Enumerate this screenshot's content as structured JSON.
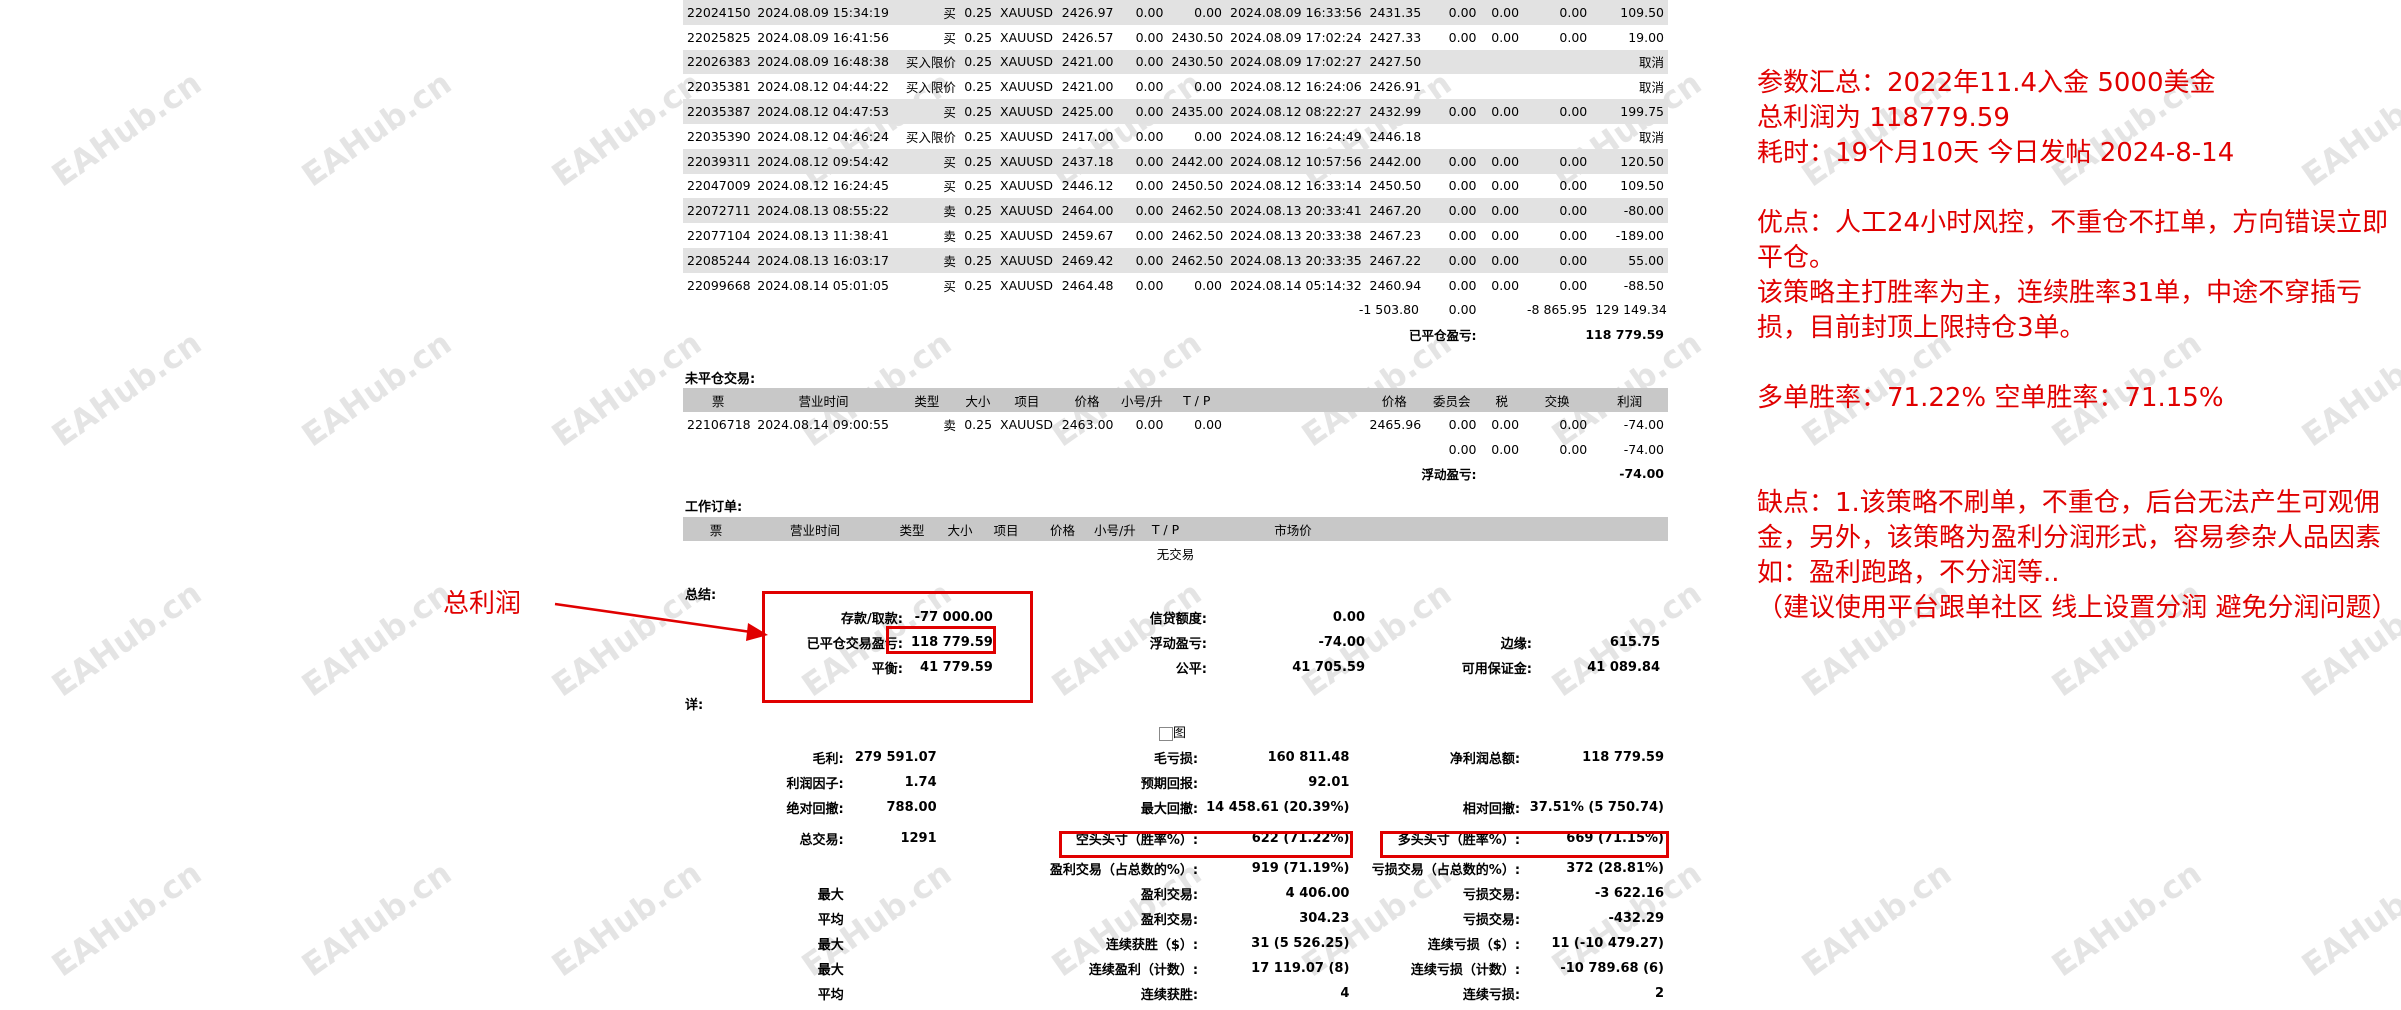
{
  "closed_trades": [
    [
      "22024150",
      "2024.08.09 15:34:19",
      "买",
      "0.25",
      "XAUUSD",
      "2426.97",
      "0.00",
      "0.00",
      "2024.08.09 16:33:56",
      "2431.35",
      "0.00",
      "0.00",
      "0.00",
      "109.50"
    ],
    [
      "22025825",
      "2024.08.09 16:41:56",
      "买",
      "0.25",
      "XAUUSD",
      "2426.57",
      "0.00",
      "2430.50",
      "2024.08.09 17:02:24",
      "2427.33",
      "0.00",
      "0.00",
      "0.00",
      "19.00"
    ],
    [
      "22026383",
      "2024.08.09 16:48:38",
      "买入限价",
      "0.25",
      "XAUUSD",
      "2421.00",
      "0.00",
      "2430.50",
      "2024.08.09 17:02:27",
      "2427.50",
      "",
      "",
      "",
      "取消"
    ],
    [
      "22035381",
      "2024.08.12 04:44:22",
      "买入限价",
      "0.25",
      "XAUUSD",
      "2421.00",
      "0.00",
      "0.00",
      "2024.08.12 16:24:06",
      "2426.91",
      "",
      "",
      "",
      "取消"
    ],
    [
      "22035387",
      "2024.08.12 04:47:53",
      "买",
      "0.25",
      "XAUUSD",
      "2425.00",
      "0.00",
      "2435.00",
      "2024.08.12 08:22:27",
      "2432.99",
      "0.00",
      "0.00",
      "0.00",
      "199.75"
    ],
    [
      "22035390",
      "2024.08.12 04:46:24",
      "买入限价",
      "0.25",
      "XAUUSD",
      "2417.00",
      "0.00",
      "0.00",
      "2024.08.12 16:24:49",
      "2446.18",
      "",
      "",
      "",
      "取消"
    ],
    [
      "22039311",
      "2024.08.12 09:54:42",
      "买",
      "0.25",
      "XAUUSD",
      "2437.18",
      "0.00",
      "2442.00",
      "2024.08.12 10:57:56",
      "2442.00",
      "0.00",
      "0.00",
      "0.00",
      "120.50"
    ],
    [
      "22047009",
      "2024.08.12 16:24:45",
      "买",
      "0.25",
      "XAUUSD",
      "2446.12",
      "0.00",
      "2450.50",
      "2024.08.12 16:33:14",
      "2450.50",
      "0.00",
      "0.00",
      "0.00",
      "109.50"
    ],
    [
      "22072711",
      "2024.08.13 08:55:22",
      "卖",
      "0.25",
      "XAUUSD",
      "2464.00",
      "0.00",
      "2462.50",
      "2024.08.13 20:33:41",
      "2467.20",
      "0.00",
      "0.00",
      "0.00",
      "-80.00"
    ],
    [
      "22077104",
      "2024.08.13 11:38:41",
      "卖",
      "0.25",
      "XAUUSD",
      "2459.67",
      "0.00",
      "2462.50",
      "2024.08.13 20:33:38",
      "2467.23",
      "0.00",
      "0.00",
      "0.00",
      "-189.00"
    ],
    [
      "22085244",
      "2024.08.13 16:03:17",
      "卖",
      "0.25",
      "XAUUSD",
      "2469.42",
      "0.00",
      "2462.50",
      "2024.08.13 20:33:35",
      "2467.22",
      "0.00",
      "0.00",
      "0.00",
      "55.00"
    ],
    [
      "22099668",
      "2024.08.14 05:01:05",
      "买",
      "0.25",
      "XAUUSD",
      "2464.48",
      "0.00",
      "0.00",
      "2024.08.14 05:14:32",
      "2460.94",
      "0.00",
      "0.00",
      "0.00",
      "-88.50"
    ]
  ],
  "closed_totals": {
    "commission": "-1 503.80",
    "tax": "0.00",
    "swap": "-8 865.95",
    "profit": "129 149.34"
  },
  "closed_pl": {
    "label": "已平仓盈亏:",
    "value": "118 779.59"
  },
  "open_section": {
    "title": "未平仓交易:",
    "headers": [
      "票",
      "营业时间",
      "类型",
      "大小",
      "项目",
      "价格",
      "小号/升",
      "T / P",
      "",
      "价格",
      "委员会",
      "税",
      "交换",
      "利润"
    ],
    "row": [
      "22106718",
      "2024.08.14 09:00:55",
      "卖",
      "0.25",
      "XAUUSD",
      "2463.00",
      "0.00",
      "0.00",
      "",
      "2465.96",
      "0.00",
      "0.00",
      "0.00",
      "-74.00"
    ],
    "subtotal": [
      "0.00",
      "0.00",
      "0.00",
      "-74.00"
    ],
    "float_label": "浮动盈亏:",
    "float_value": "-74.00"
  },
  "work_section": {
    "title": "工作订单:",
    "headers": [
      "票",
      "营业时间",
      "类型",
      "大小",
      "项目",
      "价格",
      "小号/升",
      "T / P",
      "市场价",
      ""
    ],
    "empty": "无交易"
  },
  "summary": {
    "title": "总结:",
    "deposit_label": "存款/取款:",
    "deposit": "-77 000.00",
    "closed_label": "已平仓交易盈亏:",
    "closed": "118 779.59",
    "balance_label": "平衡:",
    "balance": "41 779.59",
    "credit_label": "信贷额度:",
    "credit": "0.00",
    "float_label": "浮动盈亏:",
    "float": "-74.00",
    "equity_label": "公平:",
    "equity": "41 705.59",
    "margin_label": "边缘:",
    "margin": "615.75",
    "free_label": "可用保证金:",
    "free": "41 089.84"
  },
  "details": {
    "title": "详:",
    "image_alt": "图",
    "rows": [
      [
        "毛利:",
        "279 591.07",
        "毛亏损:",
        "160 811.48",
        "净利润总额:",
        "118 779.59"
      ],
      [
        "利润因子:",
        "1.74",
        "预期回报:",
        "92.01",
        "",
        ""
      ],
      [
        "绝对回撤:",
        "788.00",
        "最大回撤:",
        "14 458.61 (20.39%)",
        "相对回撤:",
        "37.51% (5 750.74)"
      ],
      [
        "总交易:",
        "1291",
        "空头头寸（胜率%）:",
        "622 (71.22%)",
        "多头头寸（胜率%）:",
        "669 (71.15%)"
      ],
      [
        "",
        "",
        "盈利交易（占总数的%）:",
        "919 (71.19%)",
        "亏损交易（占总数的%）:",
        "372 (28.81%)"
      ],
      [
        "最大",
        "",
        "盈利交易:",
        "4 406.00",
        "亏损交易:",
        "-3 622.16"
      ],
      [
        "平均",
        "",
        "盈利交易:",
        "304.23",
        "亏损交易:",
        "-432.29"
      ],
      [
        "最大",
        "",
        "连续获胜（$）:",
        "31 (5 526.25)",
        "连续亏损（$）:",
        "11 (-10 479.27)"
      ],
      [
        "最大",
        "",
        "连续盈利（计数）:",
        "17 119.07 (8)",
        "连续亏损（计数）:",
        "-10 789.68 (6)"
      ],
      [
        "平均",
        "",
        "连续获胜:",
        "4",
        "连续亏损:",
        "2"
      ]
    ]
  },
  "annotation_label": "总利润",
  "notes": {
    "l1": "参数汇总：2022年11.4入金 5000美金",
    "l2": "总利润为 118779.59",
    "l3": "耗时：19个月10天 今日发帖 2024-8-14",
    "l4": "优点：人工24小时风控，不重仓不扛单，方向错误立即平仓。",
    "l5": "该策略主打胜率为主，连续胜率31单，中途不穿插亏损，目前封顶上限持仓3单。",
    "l6": "多单胜率：71.22%  空单胜率：71.15%",
    "l7": "缺点：1.该策略不刷单，不重仓，后台无法产生可观佣金，另外，该策略为盈利分润形式，容易参杂人品因素如：盈利跑路，不分润等..",
    "l8": "（建议使用平台跟单社区 线上设置分润 避免分润问题）"
  },
  "watermark": "EAHub.cn",
  "colors": {
    "accent": "#e00000",
    "row_gray": "#e2e2e2",
    "header_gray": "#c8c8c8"
  }
}
